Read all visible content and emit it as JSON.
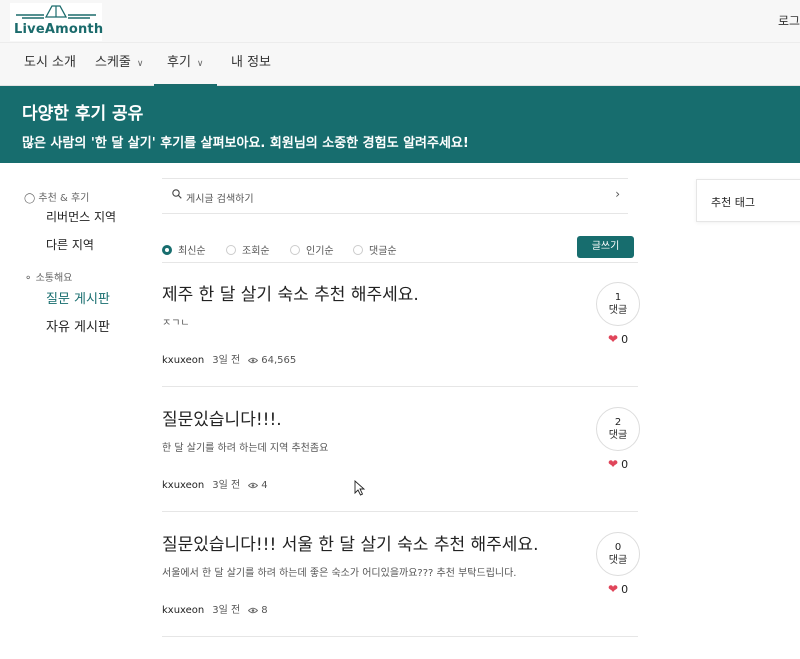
{
  "header": {
    "logo_text": "LiveAmonth",
    "login_label": "로그인"
  },
  "nav": [
    {
      "label": "도시 소개",
      "has_dropdown": false,
      "active": false
    },
    {
      "label": "스케줄",
      "has_dropdown": true,
      "active": false
    },
    {
      "label": "후기",
      "has_dropdown": true,
      "active": true
    },
    {
      "label": "내 정보",
      "has_dropdown": false,
      "active": false
    }
  ],
  "banner": {
    "title": "다양한 후기 공유",
    "subtitle": "많은 사람의 '한 달 살기' 후기를 살펴보아요. 회원님의 소중한 경험도 알려주세요!"
  },
  "sidebar": {
    "groups": [
      {
        "heading": "추천 & 후기",
        "icon": "user-icon",
        "items": [
          "리버먼스 지역",
          "다른 지역"
        ]
      },
      {
        "heading": "소통해요",
        "icon": "tag-icon",
        "items": [
          "질문 게시판",
          "자유 게시판"
        ]
      }
    ],
    "active_item": "질문 게시판"
  },
  "search": {
    "placeholder": "게시글 검색하기"
  },
  "sort_options": [
    {
      "label": "최신순",
      "selected": true
    },
    {
      "label": "조회순",
      "selected": false
    },
    {
      "label": "인기순",
      "selected": false
    },
    {
      "label": "댓글순",
      "selected": false
    }
  ],
  "write_button": "글쓰기",
  "posts": [
    {
      "title": "제주 한 달 살기 숙소 추천 해주세요.",
      "excerpt": "ㅈㄱㄴ",
      "author": "kxuxeon",
      "time": "3일 전",
      "views": "64,565",
      "comments": "1",
      "comment_label": "댓글",
      "likes": "0"
    },
    {
      "title": "질문있습니다!!!.",
      "excerpt": "한 달 살기를 하려 하는데 지역 추천좀요",
      "author": "kxuxeon",
      "time": "3일 전",
      "views": "4",
      "comments": "2",
      "comment_label": "댓글",
      "likes": "0"
    },
    {
      "title": "질문있습니다!!! 서울 한 달 살기 숙소 추천 해주세요.",
      "excerpt": "서울에서 한 달 살기를 하려 하는데 좋은 숙소가 어디있을까요??? 추천 부탁드립니다.",
      "author": "kxuxeon",
      "time": "3일 전",
      "views": "8",
      "comments": "0",
      "comment_label": "댓글",
      "likes": "0"
    }
  ],
  "right_panel": {
    "title": "추천 태그"
  },
  "colors": {
    "brand": "#176d6e",
    "heart": "#e0455a"
  }
}
